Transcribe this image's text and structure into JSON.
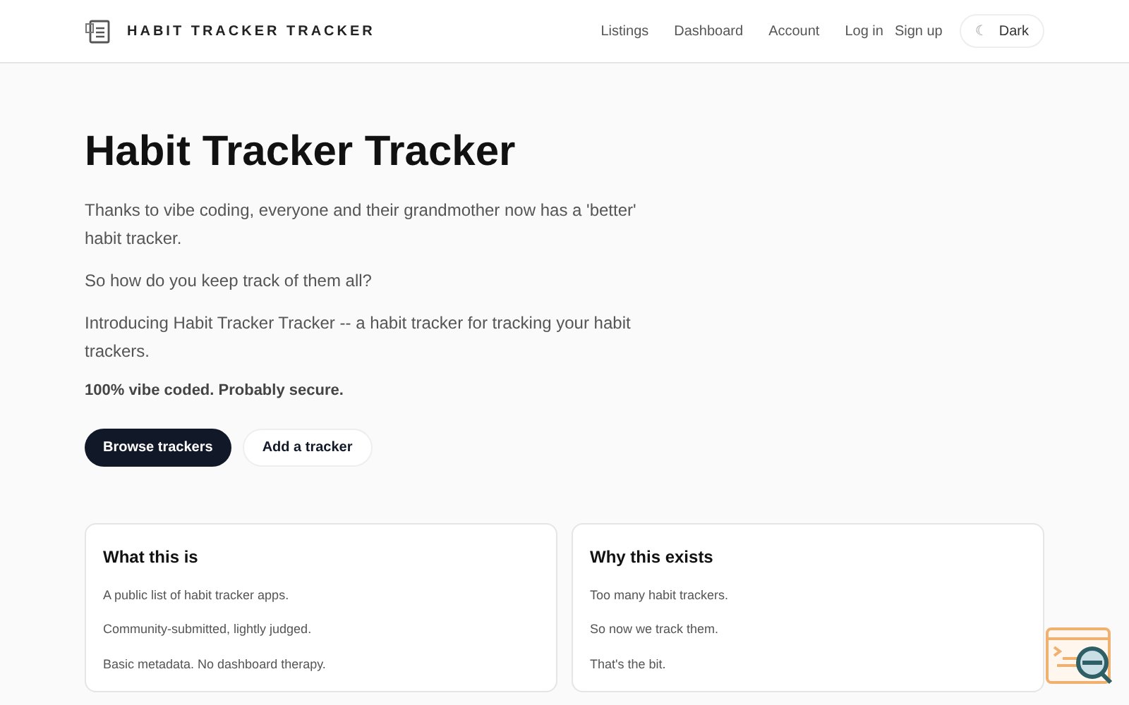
{
  "header": {
    "brand": "HABIT TRACKER TRACKER",
    "nav": [
      "Listings",
      "Dashboard",
      "Account",
      "Log in",
      "Sign up"
    ],
    "theme_button": {
      "icon": "☾",
      "label": "Dark"
    }
  },
  "hero": {
    "title": "Habit Tracker Tracker",
    "paragraphs": [
      "Thanks to vibe coding, everyone and their grandmother now has a 'better' habit tracker.",
      "So how do you keep track of them all?",
      "Introducing Habit Tracker Tracker -- a habit tracker for tracking your habit trackers."
    ],
    "note": "100% vibe coded. Probably secure.",
    "buttons": [
      {
        "label": "Browse trackers",
        "kind": "primary"
      },
      {
        "label": "Add a tracker",
        "kind": "secondary"
      }
    ]
  },
  "cards": [
    {
      "title": "What this is",
      "lines": [
        "A public list of habit tracker apps.",
        "Community-submitted, lightly judged.",
        "Basic metadata. No dashboard therapy."
      ]
    },
    {
      "title": "Why this exists",
      "lines": [
        "Too many habit trackers.",
        "So now we track them.",
        "That's the bit."
      ]
    }
  ]
}
